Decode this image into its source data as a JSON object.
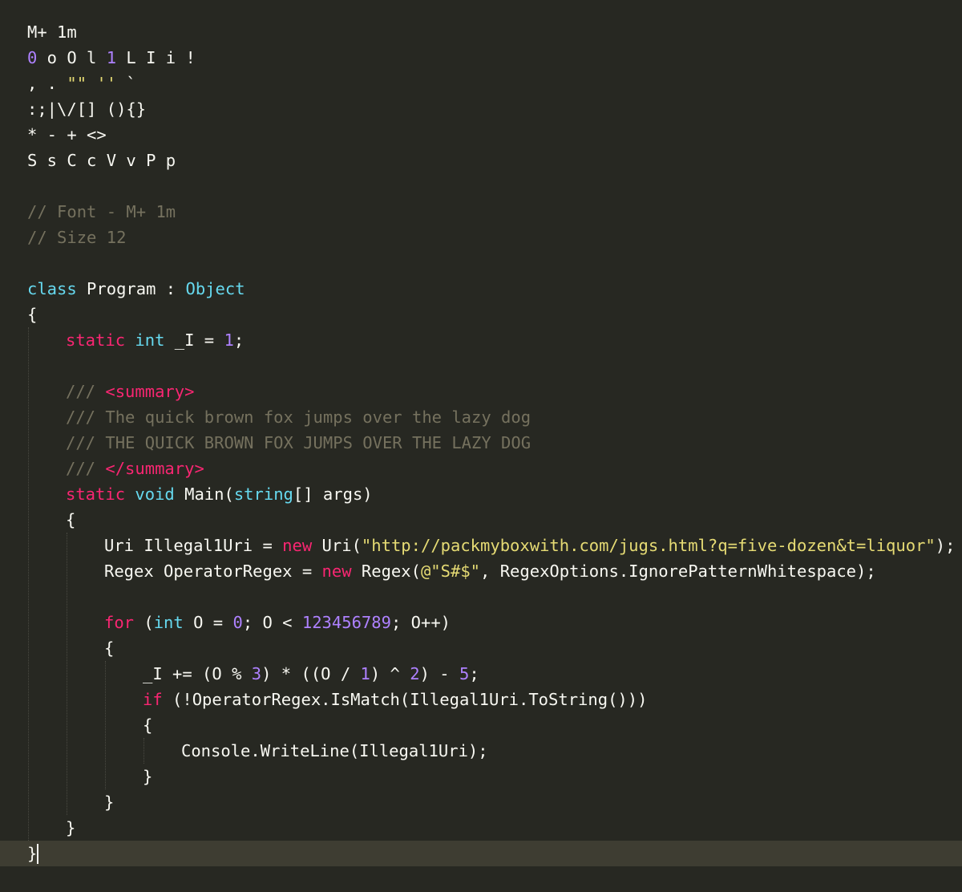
{
  "editor": {
    "theme": {
      "background": "#272822",
      "current_line": "#3e3d32",
      "indent_guide": "#4a4a42",
      "cursor": "#f8f8f0"
    },
    "colors": {
      "plain": "#f8f8f2",
      "keyword": "#f92672",
      "type": "#66d9ef",
      "number": "#ae81ff",
      "string": "#e6db74",
      "comment": "#75715e"
    },
    "cursor": {
      "line": 32
    },
    "lines": [
      {
        "indent": 0,
        "tokens": [
          {
            "t": "M+ 1m",
            "c": "plain"
          }
        ]
      },
      {
        "indent": 0,
        "tokens": [
          {
            "t": "0",
            "c": "number"
          },
          {
            "t": " o O l ",
            "c": "plain"
          },
          {
            "t": "1",
            "c": "number"
          },
          {
            "t": " L I i !",
            "c": "plain"
          }
        ]
      },
      {
        "indent": 0,
        "tokens": [
          {
            "t": ", . ",
            "c": "plain"
          },
          {
            "t": "\"\" ''",
            "c": "string"
          },
          {
            "t": " `",
            "c": "plain"
          }
        ]
      },
      {
        "indent": 0,
        "tokens": [
          {
            "t": ":;|\\/[] (){}",
            "c": "plain"
          }
        ]
      },
      {
        "indent": 0,
        "tokens": [
          {
            "t": "* - + <>",
            "c": "plain"
          }
        ]
      },
      {
        "indent": 0,
        "tokens": [
          {
            "t": "S s C c V v P p",
            "c": "plain"
          }
        ]
      },
      {
        "indent": 0,
        "tokens": []
      },
      {
        "indent": 0,
        "tokens": [
          {
            "t": "// Font - M+ 1m",
            "c": "comment"
          }
        ]
      },
      {
        "indent": 0,
        "tokens": [
          {
            "t": "// Size 12",
            "c": "comment"
          }
        ]
      },
      {
        "indent": 0,
        "tokens": []
      },
      {
        "indent": 0,
        "tokens": [
          {
            "t": "class",
            "c": "type"
          },
          {
            "t": " Program : ",
            "c": "plain"
          },
          {
            "t": "Object",
            "c": "type"
          }
        ]
      },
      {
        "indent": 0,
        "tokens": [
          {
            "t": "{",
            "c": "plain"
          }
        ]
      },
      {
        "indent": 1,
        "tokens": [
          {
            "t": "static",
            "c": "keyword"
          },
          {
            "t": " ",
            "c": "plain"
          },
          {
            "t": "int",
            "c": "type"
          },
          {
            "t": " _I = ",
            "c": "plain"
          },
          {
            "t": "1",
            "c": "number"
          },
          {
            "t": ";",
            "c": "plain"
          }
        ]
      },
      {
        "indent": 0,
        "tokens": []
      },
      {
        "indent": 1,
        "tokens": [
          {
            "t": "/// ",
            "c": "comment"
          },
          {
            "t": "<summary>",
            "c": "keyword"
          }
        ]
      },
      {
        "indent": 1,
        "tokens": [
          {
            "t": "/// The quick brown fox jumps over the lazy dog",
            "c": "comment"
          }
        ]
      },
      {
        "indent": 1,
        "tokens": [
          {
            "t": "/// THE QUICK BROWN FOX JUMPS OVER THE LAZY DOG",
            "c": "comment"
          }
        ]
      },
      {
        "indent": 1,
        "tokens": [
          {
            "t": "/// ",
            "c": "comment"
          },
          {
            "t": "</summary>",
            "c": "keyword"
          }
        ]
      },
      {
        "indent": 1,
        "tokens": [
          {
            "t": "static",
            "c": "keyword"
          },
          {
            "t": " ",
            "c": "plain"
          },
          {
            "t": "void",
            "c": "type"
          },
          {
            "t": " Main(",
            "c": "plain"
          },
          {
            "t": "string",
            "c": "type"
          },
          {
            "t": "[] args)",
            "c": "plain"
          }
        ]
      },
      {
        "indent": 1,
        "tokens": [
          {
            "t": "{",
            "c": "plain"
          }
        ]
      },
      {
        "indent": 2,
        "tokens": [
          {
            "t": "Uri Illegal1Uri = ",
            "c": "plain"
          },
          {
            "t": "new",
            "c": "keyword"
          },
          {
            "t": " Uri(",
            "c": "plain"
          },
          {
            "t": "\"http://packmyboxwith.com/jugs.html?q=five-dozen&t=liquor\"",
            "c": "string"
          },
          {
            "t": ");",
            "c": "plain"
          }
        ]
      },
      {
        "indent": 2,
        "tokens": [
          {
            "t": "Regex OperatorRegex = ",
            "c": "plain"
          },
          {
            "t": "new",
            "c": "keyword"
          },
          {
            "t": " Regex(",
            "c": "plain"
          },
          {
            "t": "@\"S#$\"",
            "c": "string"
          },
          {
            "t": ", RegexOptions.IgnorePatternWhitespace);",
            "c": "plain"
          }
        ]
      },
      {
        "indent": 0,
        "tokens": []
      },
      {
        "indent": 2,
        "tokens": [
          {
            "t": "for",
            "c": "keyword"
          },
          {
            "t": " (",
            "c": "plain"
          },
          {
            "t": "int",
            "c": "type"
          },
          {
            "t": " O = ",
            "c": "plain"
          },
          {
            "t": "0",
            "c": "number"
          },
          {
            "t": "; O < ",
            "c": "plain"
          },
          {
            "t": "123456789",
            "c": "number"
          },
          {
            "t": "; O++)",
            "c": "plain"
          }
        ]
      },
      {
        "indent": 2,
        "tokens": [
          {
            "t": "{",
            "c": "plain"
          }
        ]
      },
      {
        "indent": 3,
        "tokens": [
          {
            "t": "_I += (O % ",
            "c": "plain"
          },
          {
            "t": "3",
            "c": "number"
          },
          {
            "t": ") * ((O / ",
            "c": "plain"
          },
          {
            "t": "1",
            "c": "number"
          },
          {
            "t": ") ^ ",
            "c": "plain"
          },
          {
            "t": "2",
            "c": "number"
          },
          {
            "t": ") - ",
            "c": "plain"
          },
          {
            "t": "5",
            "c": "number"
          },
          {
            "t": ";",
            "c": "plain"
          }
        ]
      },
      {
        "indent": 3,
        "tokens": [
          {
            "t": "if",
            "c": "keyword"
          },
          {
            "t": " (!OperatorRegex.IsMatch(Illegal1Uri.ToString()))",
            "c": "plain"
          }
        ]
      },
      {
        "indent": 3,
        "tokens": [
          {
            "t": "{",
            "c": "plain"
          }
        ]
      },
      {
        "indent": 4,
        "tokens": [
          {
            "t": "Console.WriteLine(Illegal1Uri);",
            "c": "plain"
          }
        ]
      },
      {
        "indent": 3,
        "tokens": [
          {
            "t": "}",
            "c": "plain"
          }
        ]
      },
      {
        "indent": 2,
        "tokens": [
          {
            "t": "}",
            "c": "plain"
          }
        ]
      },
      {
        "indent": 1,
        "tokens": [
          {
            "t": "}",
            "c": "plain"
          }
        ]
      },
      {
        "indent": 0,
        "tokens": [
          {
            "t": "}",
            "c": "plain"
          }
        ]
      }
    ]
  }
}
